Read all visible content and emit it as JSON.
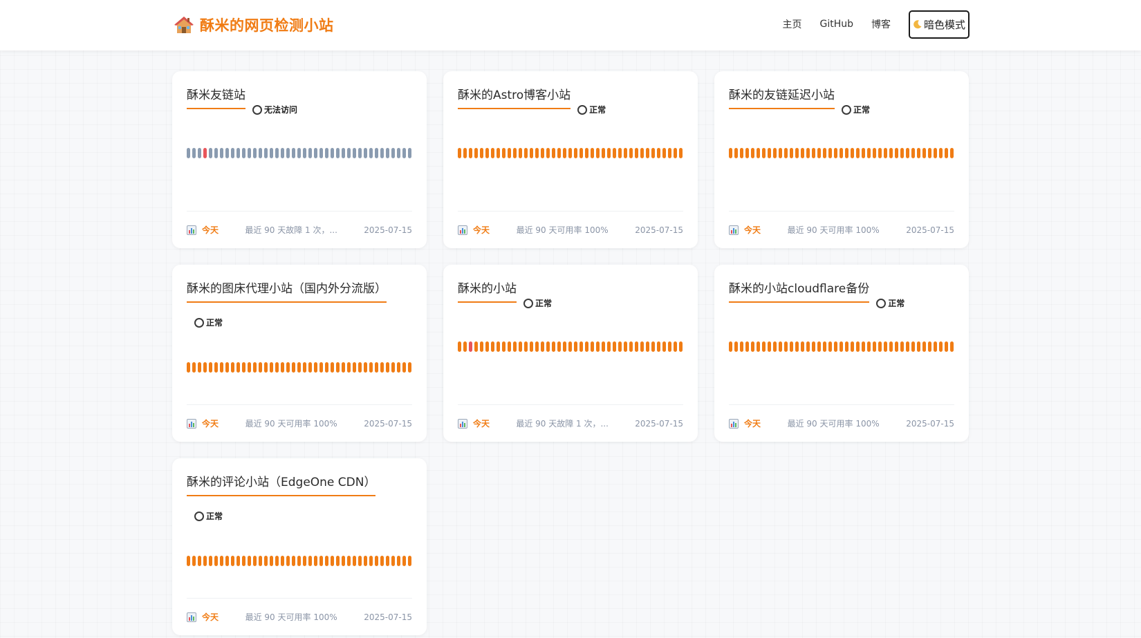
{
  "brand": {
    "icon": "house-icon",
    "title": "酥米的网页检测小站"
  },
  "nav": {
    "links": [
      "主页",
      "GitHub",
      "博客"
    ],
    "theme_button": "暗色模式",
    "theme_icon": "moon-icon"
  },
  "colors": {
    "accent": "#f07c14",
    "down": "#e8555a",
    "unknown": "#8a9bb0"
  },
  "monitors": [
    {
      "name": "酥米友链站",
      "status": "无法访问",
      "today_label": "今天",
      "summary": "最近 90 天故障 1 次，...",
      "date": "2025-07-15",
      "bars": [
        "gray",
        "gray",
        "gray",
        "down",
        "gray",
        "gray",
        "gray",
        "gray",
        "gray",
        "gray",
        "gray",
        "gray",
        "gray",
        "gray",
        "gray",
        "gray",
        "gray",
        "gray",
        "gray",
        "gray",
        "gray",
        "gray",
        "gray",
        "gray",
        "gray",
        "gray",
        "gray",
        "gray",
        "gray",
        "gray",
        "gray",
        "gray",
        "gray",
        "gray",
        "gray",
        "gray",
        "gray",
        "gray",
        "gray",
        "gray",
        "gray"
      ]
    },
    {
      "name": "酥米的Astro博客小站",
      "status": "正常",
      "today_label": "今天",
      "summary": "最近 90 天可用率 100%",
      "date": "2025-07-15",
      "bars": [
        "up",
        "up",
        "up",
        "up",
        "up",
        "up",
        "up",
        "up",
        "up",
        "up",
        "up",
        "up",
        "up",
        "up",
        "up",
        "up",
        "up",
        "up",
        "up",
        "up",
        "up",
        "up",
        "up",
        "up",
        "up",
        "up",
        "up",
        "up",
        "up",
        "up",
        "up",
        "up",
        "up",
        "up",
        "up",
        "up",
        "up",
        "up",
        "up",
        "up",
        "up"
      ]
    },
    {
      "name": "酥米的友链延迟小站",
      "status": "正常",
      "today_label": "今天",
      "summary": "最近 90 天可用率 100%",
      "date": "2025-07-15",
      "bars": [
        "up",
        "up",
        "up",
        "up",
        "up",
        "up",
        "up",
        "up",
        "up",
        "up",
        "up",
        "up",
        "up",
        "up",
        "up",
        "up",
        "up",
        "up",
        "up",
        "up",
        "up",
        "up",
        "up",
        "up",
        "up",
        "up",
        "up",
        "up",
        "up",
        "up",
        "up",
        "up",
        "up",
        "up",
        "up",
        "up",
        "up",
        "up",
        "up",
        "up",
        "up"
      ]
    },
    {
      "name": "酥米的图床代理小站（国内外分流版）",
      "status": "正常",
      "today_label": "今天",
      "summary": "最近 90 天可用率 100%",
      "date": "2025-07-15",
      "bars": [
        "up",
        "up",
        "up",
        "up",
        "up",
        "up",
        "up",
        "up",
        "up",
        "up",
        "up",
        "up",
        "up",
        "up",
        "up",
        "up",
        "up",
        "up",
        "up",
        "up",
        "up",
        "up",
        "up",
        "up",
        "up",
        "up",
        "up",
        "up",
        "up",
        "up",
        "up",
        "up",
        "up",
        "up",
        "up",
        "up",
        "up",
        "up",
        "up",
        "up",
        "up"
      ]
    },
    {
      "name": "酥米的小站",
      "status": "正常",
      "today_label": "今天",
      "summary": "最近 90 天故障 1 次，...",
      "date": "2025-07-15",
      "bars": [
        "up",
        "up",
        "down",
        "up",
        "up",
        "up",
        "up",
        "up",
        "up",
        "up",
        "up",
        "up",
        "up",
        "up",
        "up",
        "up",
        "up",
        "up",
        "up",
        "up",
        "up",
        "up",
        "up",
        "up",
        "up",
        "up",
        "up",
        "up",
        "up",
        "up",
        "up",
        "up",
        "up",
        "up",
        "up",
        "up",
        "up",
        "up",
        "up",
        "up",
        "up"
      ]
    },
    {
      "name": "酥米的小站cloudflare备份",
      "status": "正常",
      "today_label": "今天",
      "summary": "最近 90 天可用率 100%",
      "date": "2025-07-15",
      "bars": [
        "up",
        "up",
        "up",
        "up",
        "up",
        "up",
        "up",
        "up",
        "up",
        "up",
        "up",
        "up",
        "up",
        "up",
        "up",
        "up",
        "up",
        "up",
        "up",
        "up",
        "up",
        "up",
        "up",
        "up",
        "up",
        "up",
        "up",
        "up",
        "up",
        "up",
        "up",
        "up",
        "up",
        "up",
        "up",
        "up",
        "up",
        "up",
        "up",
        "up",
        "up"
      ]
    },
    {
      "name": "酥米的评论小站（EdgeOne CDN）",
      "status": "正常",
      "today_label": "今天",
      "summary": "最近 90 天可用率 100%",
      "date": "2025-07-15",
      "bars": [
        "up",
        "up",
        "up",
        "up",
        "up",
        "up",
        "up",
        "up",
        "up",
        "up",
        "up",
        "up",
        "up",
        "up",
        "up",
        "up",
        "up",
        "up",
        "up",
        "up",
        "up",
        "up",
        "up",
        "up",
        "up",
        "up",
        "up",
        "up",
        "up",
        "up",
        "up",
        "up",
        "up",
        "up",
        "up",
        "up",
        "up",
        "up",
        "up",
        "up",
        "up"
      ]
    }
  ]
}
